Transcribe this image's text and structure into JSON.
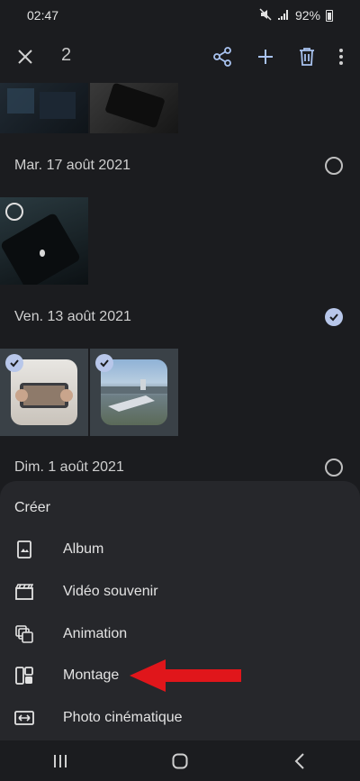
{
  "status": {
    "time": "02:47",
    "battery": "92%"
  },
  "topbar": {
    "selected_count": "2",
    "icons": [
      "close-icon",
      "share-icon",
      "add-icon",
      "trash-icon",
      "more-icon"
    ]
  },
  "groups": [
    {
      "date": "Mar. 17 août 2021",
      "selected": false
    },
    {
      "date": "Ven. 13 août 2021",
      "selected": true
    },
    {
      "date": "Dim. 1 août 2021",
      "selected": false
    }
  ],
  "sheet": {
    "title": "Créer",
    "items": [
      {
        "label": "Album",
        "icon": "album-icon"
      },
      {
        "label": "Vidéo souvenir",
        "icon": "clapperboard-icon"
      },
      {
        "label": "Animation",
        "icon": "animation-icon"
      },
      {
        "label": "Montage",
        "icon": "collage-icon"
      },
      {
        "label": "Photo cinématique",
        "icon": "cinematic-photo-icon"
      }
    ]
  },
  "colors": {
    "background": "#1b1c1f",
    "sheet": "#26272b",
    "accent": "#b8c7ea",
    "arrow": "#e0161b"
  }
}
